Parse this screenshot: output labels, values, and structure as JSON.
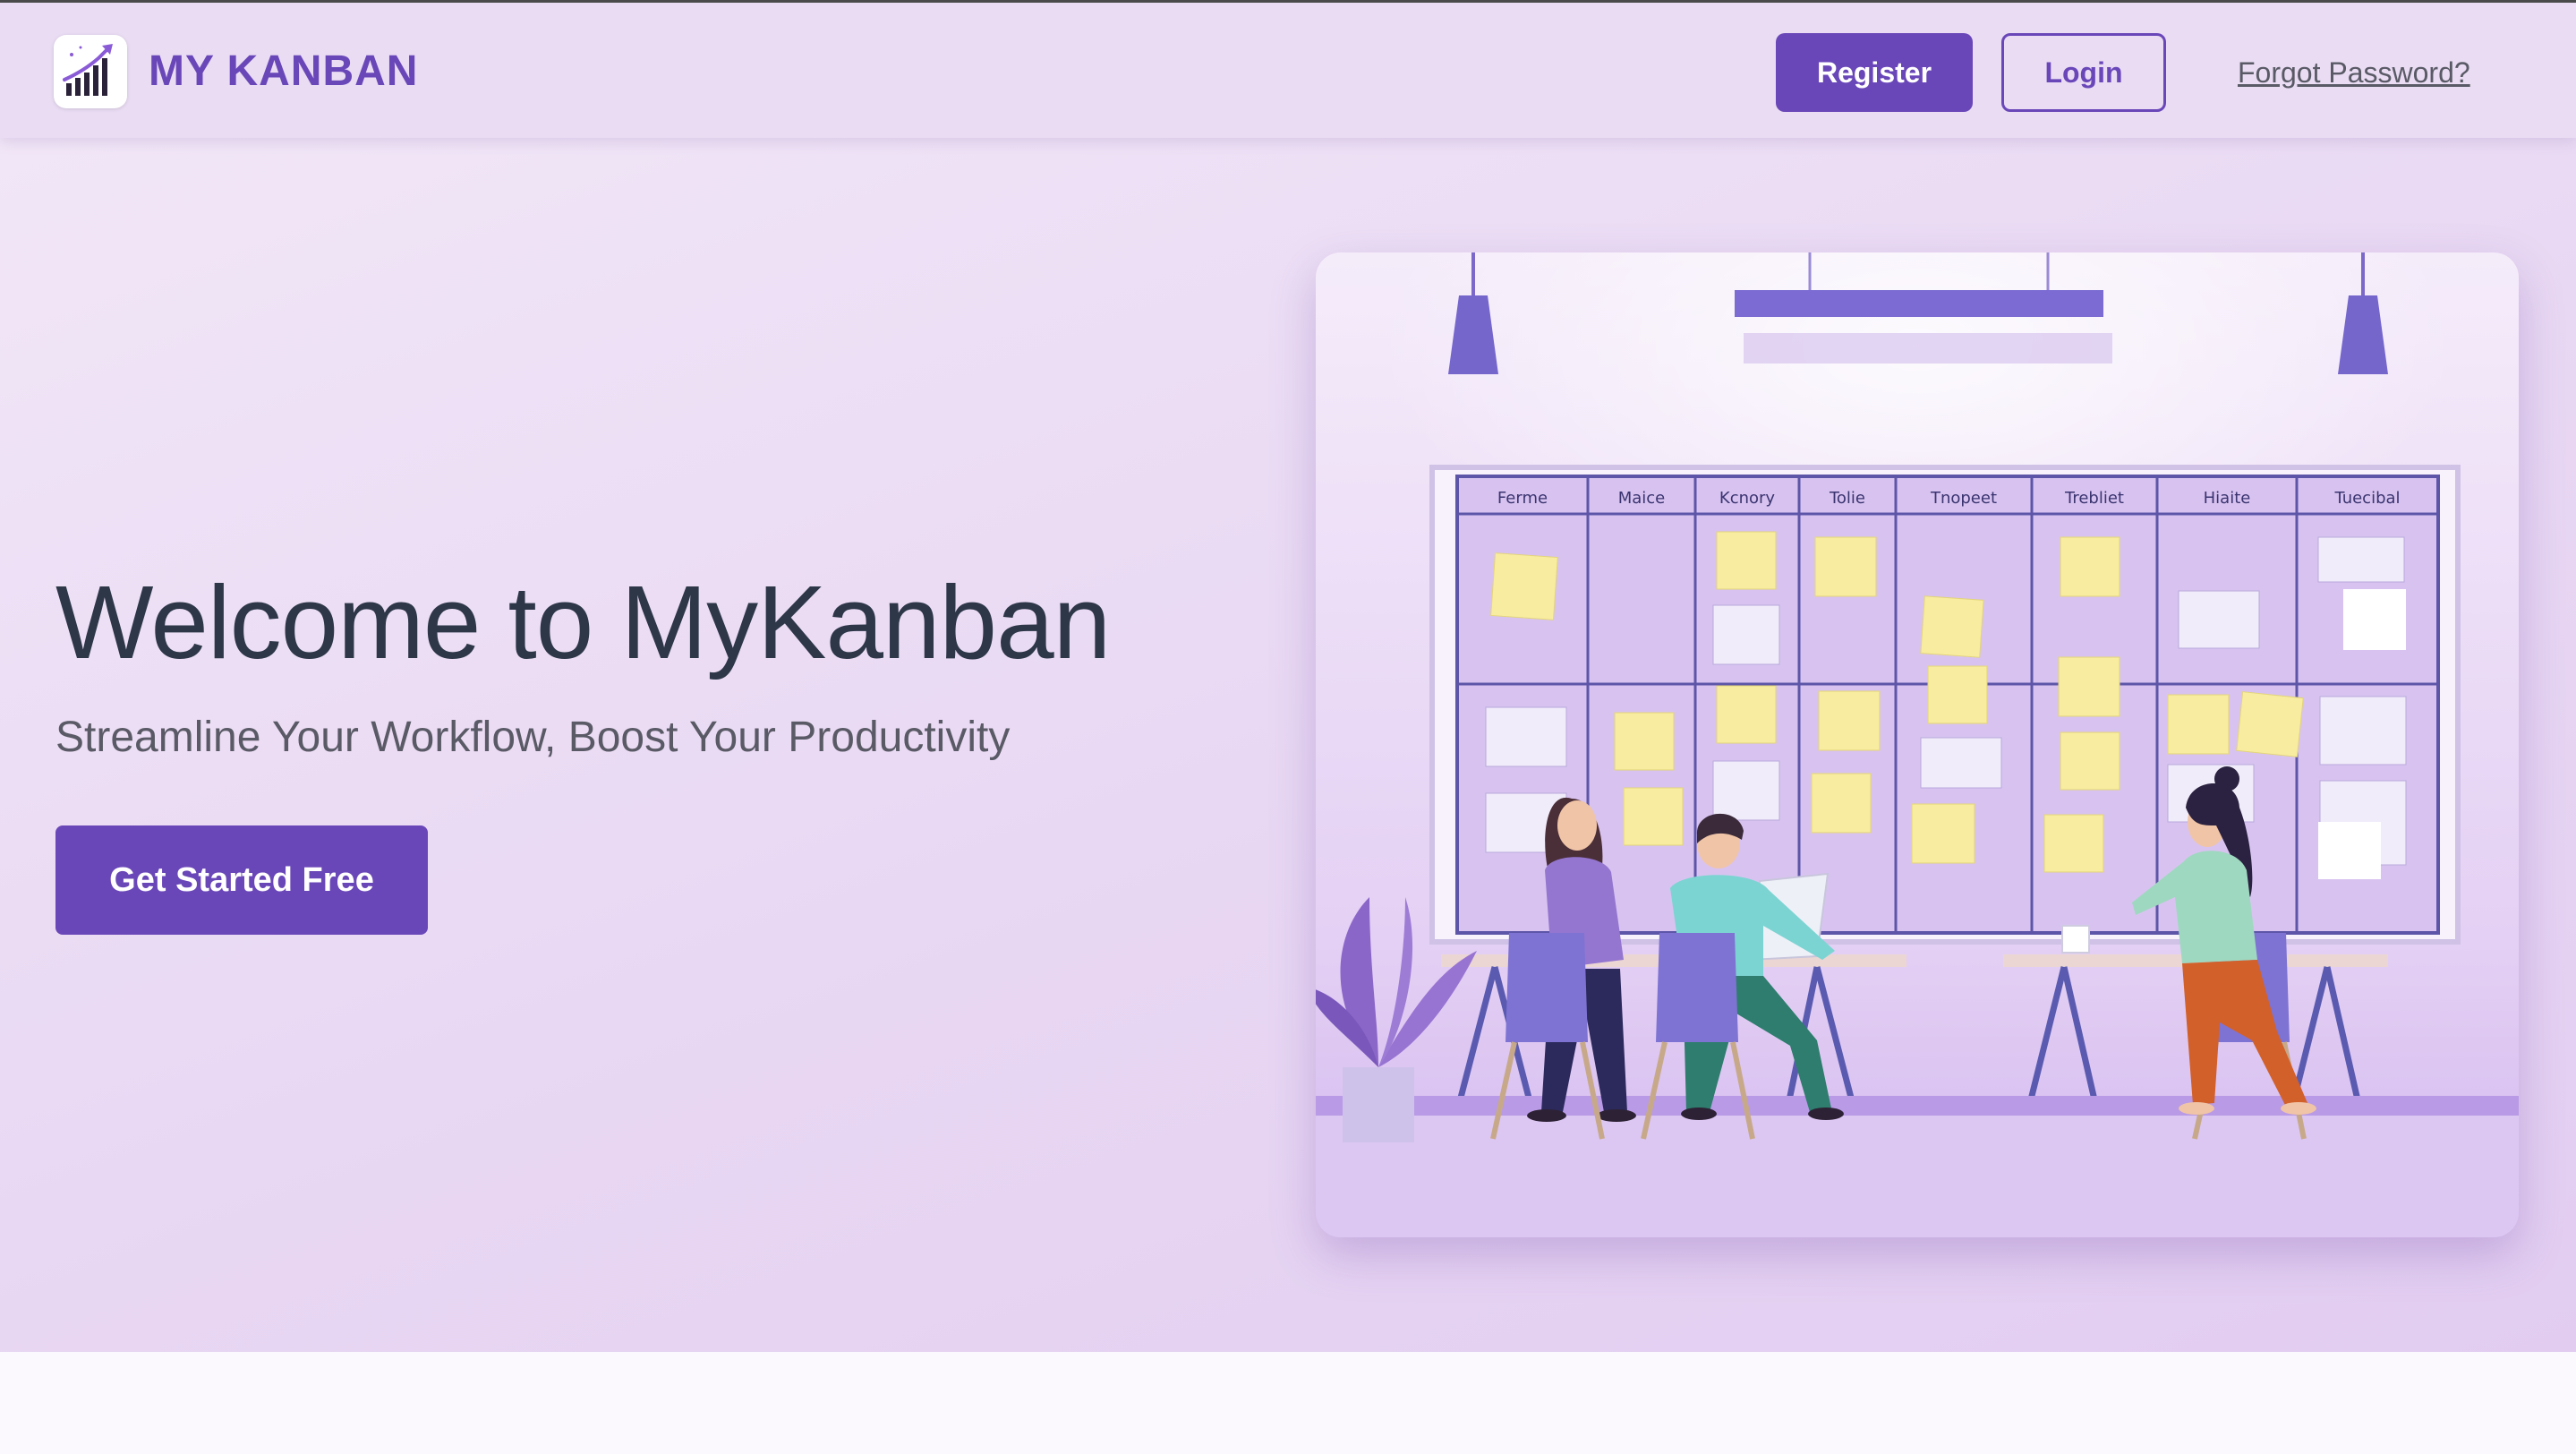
{
  "header": {
    "brand": "MY KANBAN",
    "logo_icon": "rising-chart-logo-icon",
    "register_label": "Register",
    "login_label": "Login",
    "forgot_label": "Forgot Password?"
  },
  "hero": {
    "title": "Welcome to MyKanban",
    "subtitle": "Streamline Your Workflow, Boost Your Productivity",
    "cta_label": "Get Started Free",
    "illustration": {
      "icon": "team-kanban-board-illustration",
      "board_columns": [
        "Ferme",
        "Maice",
        "Kcnory",
        "Tolie",
        "Tnopeet",
        "Trebliet",
        "Hiaite",
        "Tuecibal"
      ]
    }
  },
  "colors": {
    "accent": "#6a47b8",
    "header_bg": "#e9dcf3",
    "hero_bg": "#eadcf5",
    "title": "#2d3748",
    "subtitle": "#5a5a66",
    "sticky_note": "#f7ec9f"
  }
}
